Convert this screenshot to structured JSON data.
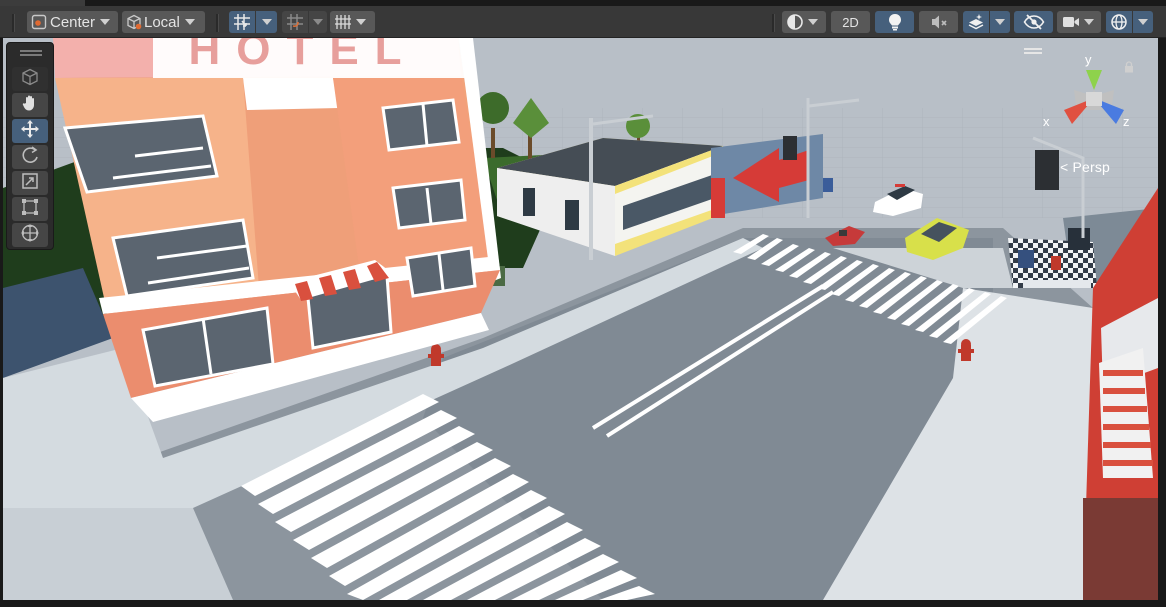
{
  "toolbar": {
    "pivot_mode": "Center",
    "pivot_rotation": "Local",
    "view_2d_label": "2D",
    "icons": [
      "pivot-icon",
      "local-rotation-icon",
      "grid-snap-icon",
      "increment-snap-icon",
      "grid-visibility-icon",
      "draw-mode-icon",
      "lighting-icon",
      "audio-mute-icon",
      "effects-icon",
      "scene-visibility-icon",
      "camera-icon",
      "gizmos-icon"
    ]
  },
  "tools": [
    "view-tool",
    "move-tool",
    "rotate-tool",
    "scale-tool",
    "rect-tool",
    "transform-tool"
  ],
  "active_tool": "move-tool",
  "gizmo": {
    "y_label": "y",
    "x_label": "x",
    "z_label": "z",
    "projection": "Persp",
    "colors": {
      "x": "#e05040",
      "y": "#8ed24c",
      "z": "#4a7be0"
    }
  },
  "scene": {
    "hotel_sign": "HOTEL",
    "colors": {
      "sky": "#b9c0c8",
      "road": "#8a939c",
      "sidewalk": "#d7dde2",
      "hotel": "#f2a27a",
      "accent_red": "#d63b37",
      "shop_trim": "#f3e27a"
    }
  }
}
